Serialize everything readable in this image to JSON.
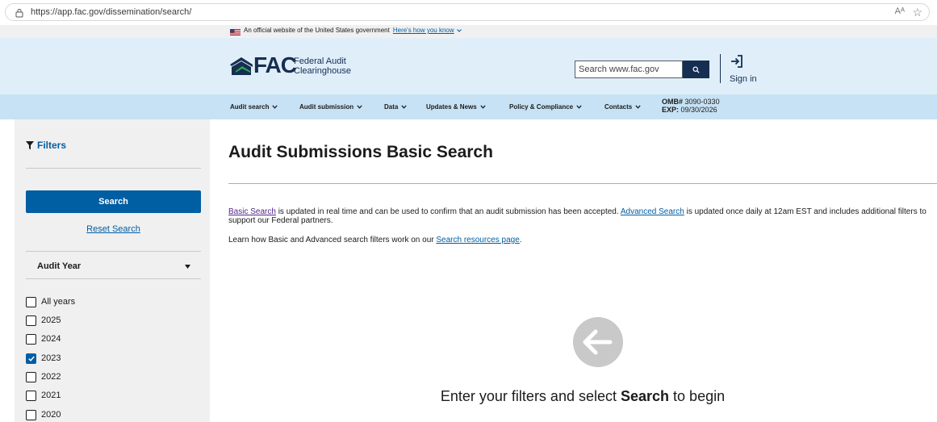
{
  "browser": {
    "url": "https://app.fac.gov/dissemination/search/",
    "read_aloud": "Aᴬ",
    "favorite": "☆"
  },
  "banner": {
    "text": "An official website of the United States government",
    "link": "Here's how you know"
  },
  "header": {
    "logo": "FAC",
    "subtitle_line1": "Federal Audit",
    "subtitle_line2": "Clearinghouse",
    "search_placeholder": "Search www.fac.gov",
    "signin": "Sign in"
  },
  "nav": {
    "items": [
      {
        "label": "Audit search"
      },
      {
        "label": "Audit submission"
      },
      {
        "label": "Data"
      },
      {
        "label": "Updates & News"
      },
      {
        "label": "Policy & Compliance"
      },
      {
        "label": "Contacts"
      }
    ],
    "omb_label": "OMB#",
    "omb_value": "3090-0330",
    "exp_label": "EXP:",
    "exp_value": "09/30/2026"
  },
  "sidebar": {
    "filters_title": "Filters",
    "search_button": "Search",
    "reset_link": "Reset Search",
    "audit_year_label": "Audit Year",
    "years": [
      {
        "label": "All years",
        "checked": false
      },
      {
        "label": "2025",
        "checked": false
      },
      {
        "label": "2024",
        "checked": false
      },
      {
        "label": "2023",
        "checked": true
      },
      {
        "label": "2022",
        "checked": false
      },
      {
        "label": "2021",
        "checked": false
      },
      {
        "label": "2020",
        "checked": false
      }
    ]
  },
  "main": {
    "title": "Audit Submissions Basic Search",
    "intro_link1": "Basic Search",
    "intro_text1": " is updated in real time and can be used to confirm that an audit submission has been accepted. ",
    "intro_link2": "Advanced Search",
    "intro_text2": " is updated once daily at 12am EST and includes additional filters to support our Federal partners.",
    "learn_text": "Learn how Basic and Advanced search filters work on our ",
    "learn_link": "Search resources page",
    "learn_end": ".",
    "empty_pre": "Enter your filters and select ",
    "empty_bold": "Search",
    "empty_post": " to begin"
  },
  "colors": {
    "primary": "#005ea2",
    "header_bg": "#dfeef9",
    "nav_bg": "#c6e2f4",
    "navy": "#162e51",
    "visited": "#54278f"
  }
}
